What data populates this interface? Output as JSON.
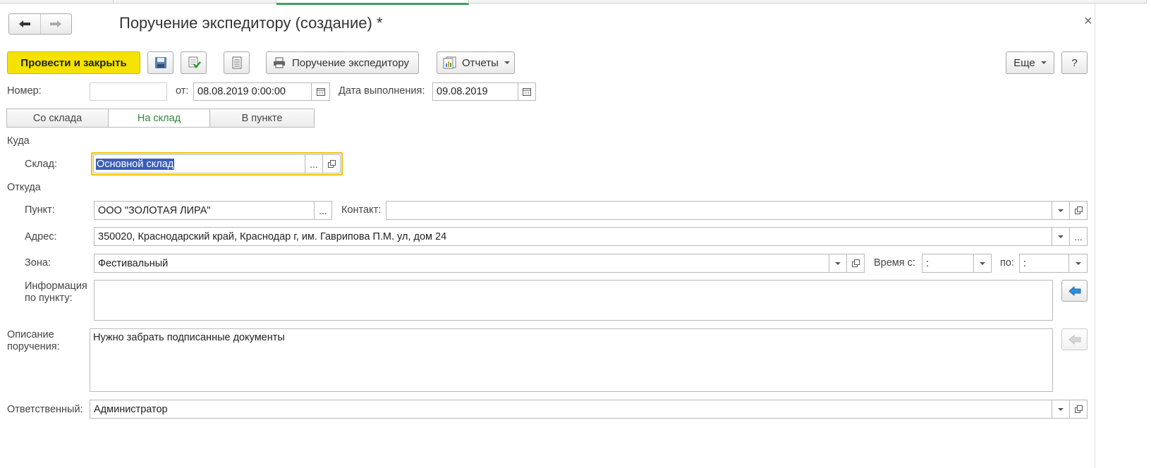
{
  "window": {
    "title": "Поручение экспедитору (создание) *",
    "close_glyph": "×"
  },
  "toolbar": {
    "post_close_label": "Провести и закрыть",
    "print_label": "Поручение экспедитору",
    "reports_label": "Отчеты",
    "more_label": "Еще",
    "help_label": "?"
  },
  "header": {
    "number_label": "Номер:",
    "number_value": "",
    "from_label": "от:",
    "from_value": "08.08.2019  0:00:00",
    "exec_date_label": "Дата выполнения:",
    "exec_date_value": "09.08.2019"
  },
  "tabs": [
    {
      "label": "Со склада",
      "active": false
    },
    {
      "label": "На склад",
      "active": true
    },
    {
      "label": "В пункте",
      "active": false
    }
  ],
  "to_section": {
    "title": "Куда",
    "warehouse_label": "Склад:",
    "warehouse_value": "Основной склад"
  },
  "from_section": {
    "title": "Откуда",
    "point_label": "Пункт:",
    "point_value": "ООО \"ЗОЛОТАЯ ЛИРА\"",
    "contact_label": "Контакт:",
    "contact_value": "",
    "address_label": "Адрес:",
    "address_value": "350020, Краснодарский край, Краснодар г, им. Гаврипова П.М. ул, дом 24",
    "zone_label": "Зона:",
    "zone_value": "Фестивальный",
    "time_from_label": "Время с:",
    "time_from_value": " :",
    "time_to_label": "по:",
    "time_to_value": " :",
    "info_label_line1": "Информация",
    "info_label_line2": "по пункту:",
    "info_value": ""
  },
  "description": {
    "label_line1": "Описание",
    "label_line2": "поручения:",
    "value": "Нужно забрать подписанные документы"
  },
  "responsible": {
    "label": "Ответственный:",
    "value": "Администратор"
  },
  "glyphs": {
    "ellipsis": "...",
    "back_arrow": "←",
    "forward_arrow": "→"
  },
  "colors": {
    "primary_button": "#f6e200",
    "active_tab_text": "#2e8b3e",
    "focus_border": "#f2c200",
    "selection": "#3c5fb5"
  }
}
